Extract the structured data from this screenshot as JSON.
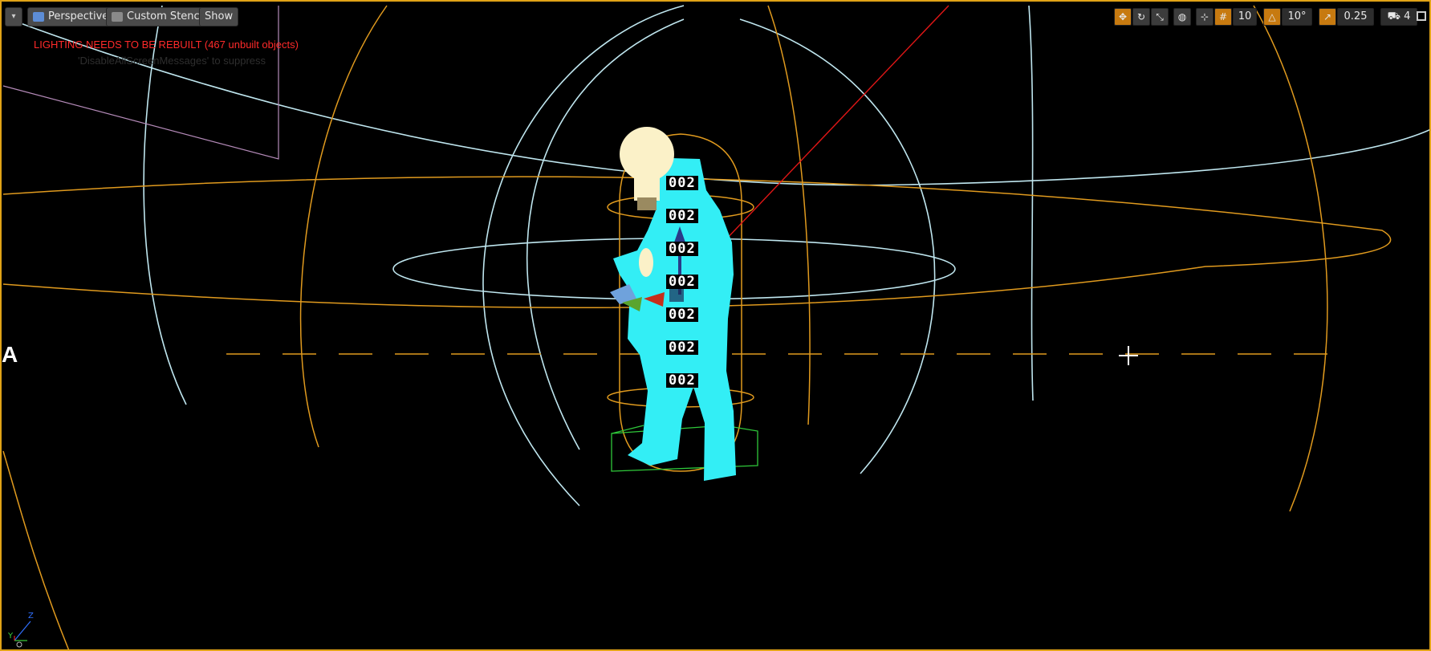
{
  "toolbar": {
    "menu_icon": "chevron-down-icon",
    "view_mode": "Perspective",
    "view_mode_icon": "perspective-cube-icon",
    "show_flags": "Custom Stencil",
    "show_flags_icon": "stencil-icon",
    "show_label": "Show"
  },
  "right_toolbar": {
    "grid_snap_value": "10",
    "rotation_snap_value": "10°",
    "scale_snap_value": "0.25",
    "camera_speed_value": "4",
    "icons": [
      "translate-icon",
      "rotate-icon",
      "scale-icon",
      "world-local-icon",
      "surface-snap-icon",
      "grid-snap-icon",
      "rotation-snap-icon",
      "scale-snap-icon",
      "camera-speed-icon",
      "maximize-icon"
    ]
  },
  "messages": {
    "warning": "LIGHTING NEEDS TO BE REBUILT (467 unbuilt objects)",
    "hint": "'DisableAllScreenMessages' to suppress"
  },
  "scene": {
    "label_text": "002",
    "edge_glyph": "A",
    "wire_color_light": "#bfe6ef",
    "wire_color_orange": "#e09a1e",
    "mesh_color": "#33eef5",
    "bulb_color": "#fbf1c8"
  },
  "axis": {
    "z": "Z",
    "y": "Y"
  },
  "colors": {
    "accent": "#e0a317",
    "warning": "#ff2a2a",
    "active_button": "#c77a10"
  }
}
